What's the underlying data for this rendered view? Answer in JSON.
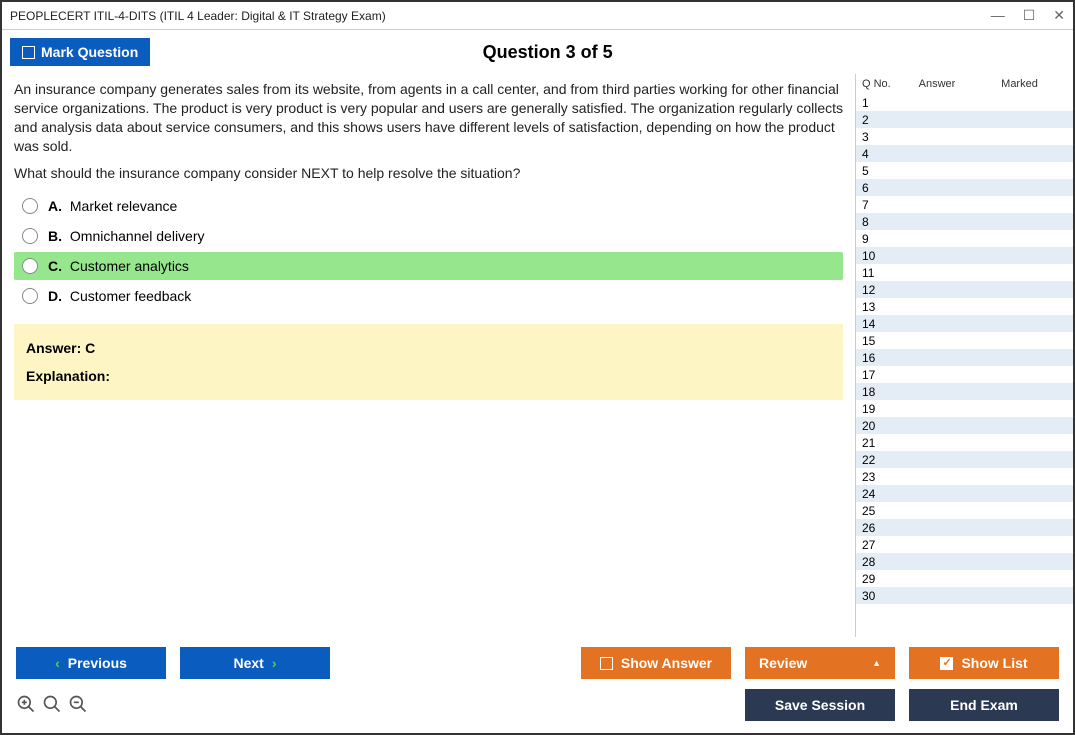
{
  "window": {
    "title": "PEOPLECERT ITIL-4-DITS (ITIL 4 Leader: Digital & IT Strategy Exam)"
  },
  "header": {
    "mark_label": "Mark Question",
    "question_title": "Question 3 of 5"
  },
  "question": {
    "para1": "An insurance company generates sales from its website, from agents in a call center, and from third parties working for other financial service organizations. The product is very product is very popular and users are generally satisfied. The organization regularly collects and analysis data about service consumers, and this shows users have different levels of satisfaction, depending on how the product was sold.",
    "para2": "What should the insurance company consider NEXT to help resolve the situation?",
    "options": [
      {
        "letter": "A.",
        "text": "Market relevance",
        "correct": false
      },
      {
        "letter": "B.",
        "text": "Omnichannel delivery",
        "correct": false
      },
      {
        "letter": "C.",
        "text": "Customer analytics",
        "correct": true
      },
      {
        "letter": "D.",
        "text": "Customer feedback",
        "correct": false
      }
    ],
    "answer_line": "Answer: C",
    "explanation_label": "Explanation:"
  },
  "side": {
    "col_q": "Q No.",
    "col_a": "Answer",
    "col_m": "Marked",
    "rows": 30
  },
  "footer": {
    "previous": "Previous",
    "next": "Next",
    "show_answer": "Show Answer",
    "review": "Review",
    "show_list": "Show List",
    "save_session": "Save Session",
    "end_exam": "End Exam"
  }
}
